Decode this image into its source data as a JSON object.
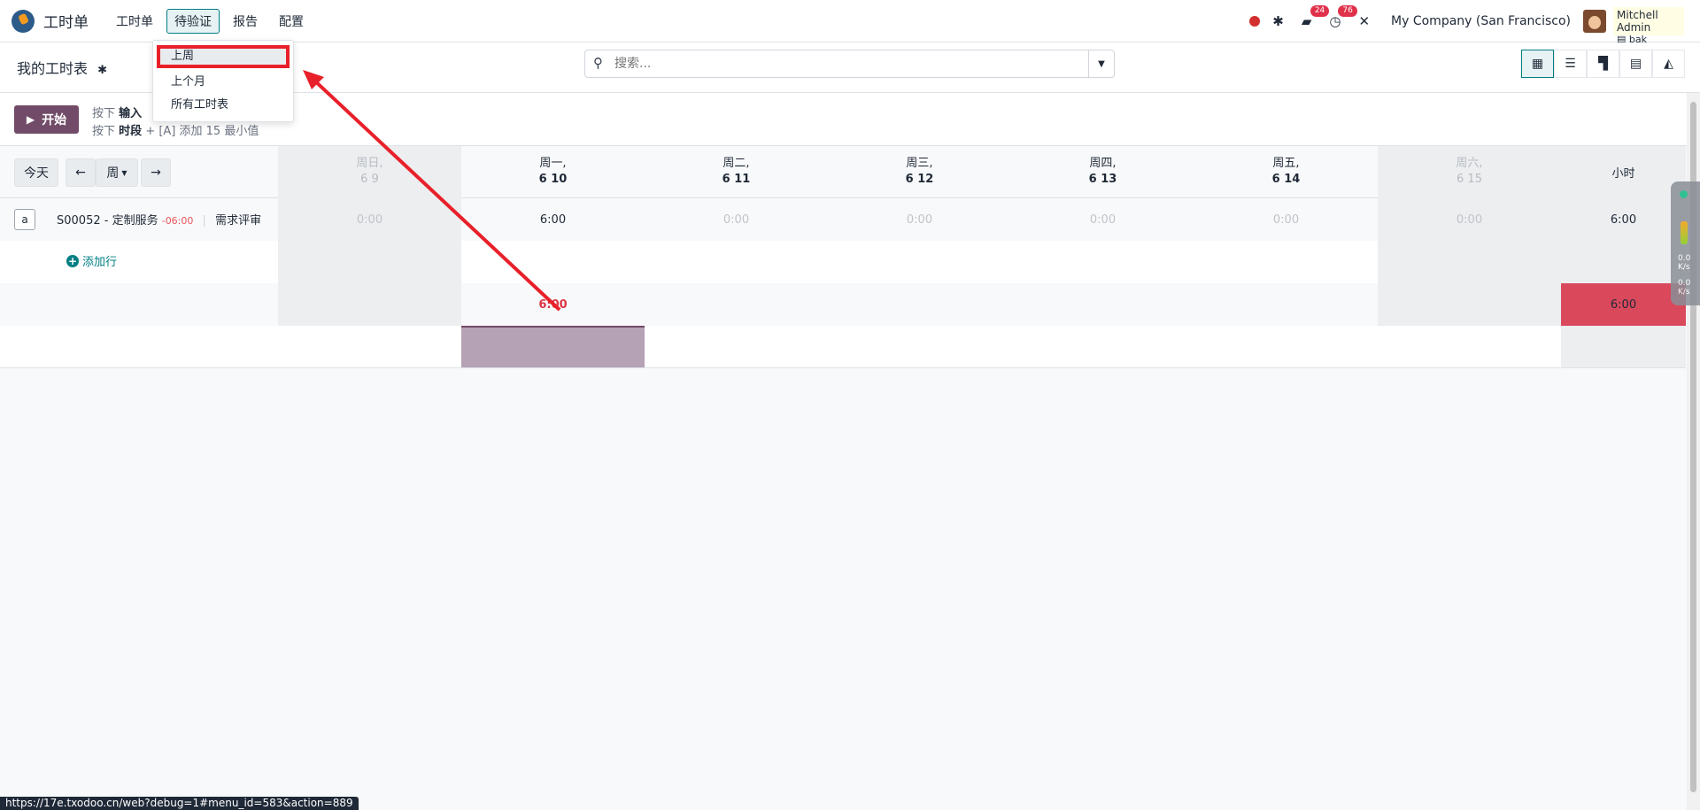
{
  "navbar": {
    "app_title": "工时单",
    "menu": [
      "工时单",
      "待验证",
      "报告",
      "配置"
    ],
    "active_menu": "待验证",
    "chat_badge": "24",
    "activity_badge": "76",
    "company": "My Company (San Francisco)",
    "user_name": "Mitchell Admin",
    "user_db": "bak"
  },
  "dropdown": {
    "items": [
      "上周",
      "上个月",
      "所有工时表"
    ]
  },
  "control_panel": {
    "title": "我的工时表",
    "search_placeholder": "搜索..."
  },
  "timer": {
    "start_label": "开始",
    "hint1_prefix": "按下",
    "hint1_bold": "输入",
    "hint2_prefix": "按下",
    "hint2_bold": "时段",
    "hint2_suffix": "+ [A] 添加 15 最小值"
  },
  "grid": {
    "today_btn": "今天",
    "prev_icon": "←",
    "period_btn": "周",
    "next_icon": "→",
    "days": [
      {
        "name": "周日,",
        "date": "6 9",
        "weekend": true
      },
      {
        "name": "周一,",
        "date": "6 10",
        "weekend": false
      },
      {
        "name": "周二,",
        "date": "6 11",
        "weekend": false
      },
      {
        "name": "周三,",
        "date": "6 12",
        "weekend": false
      },
      {
        "name": "周四,",
        "date": "6 13",
        "weekend": false
      },
      {
        "name": "周五,",
        "date": "6 14",
        "weekend": false
      },
      {
        "name": "周六,",
        "date": "6 15",
        "weekend": true
      }
    ],
    "hours_header": "小时",
    "task": {
      "avatar_letter": "a",
      "name": "S00052 - 定制服务",
      "deadline": "-06:00",
      "task_name": "需求评审",
      "values": [
        "0:00",
        "6:00",
        "0:00",
        "0:00",
        "0:00",
        "0:00",
        "0:00"
      ],
      "total": "6:00"
    },
    "add_line_label": "添加行",
    "totals": {
      "monday": "6:00",
      "week_total": "6:00"
    }
  },
  "status_url": "https://17e.txodoo.cn/web?debug=1#menu_id=583&action=889",
  "side_widget": {
    "up": "0.0",
    "down": "0.0",
    "unit": "K/s"
  },
  "colors": {
    "brand": "#714b67",
    "accent": "#017e84",
    "danger": "#e0314b",
    "highlight": "#e8202a"
  }
}
